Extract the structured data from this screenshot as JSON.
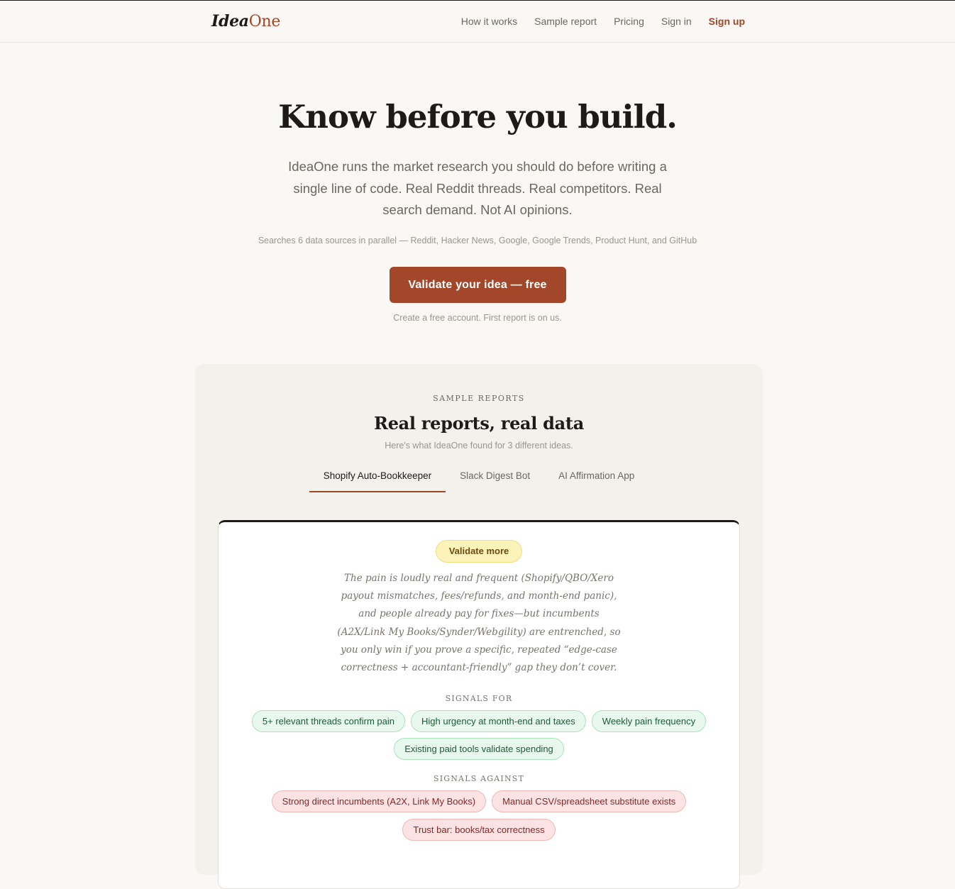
{
  "header": {
    "logo_part1": "Idea",
    "logo_part2": "One",
    "nav": [
      {
        "label": "How it works"
      },
      {
        "label": "Sample report"
      },
      {
        "label": "Pricing"
      },
      {
        "label": "Sign in"
      },
      {
        "label": "Sign up"
      }
    ]
  },
  "hero": {
    "title": "Know before you build.",
    "lead": "IdeaOne runs the market research you should do before writing a single line of code. Real Reddit threads. Real competitors. Real search demand. Not AI opinions.",
    "sources": "Searches 6 data sources in parallel — Reddit, Hacker News, Google, Google Trends, Product Hunt, and GitHub",
    "cta_label": "Validate your idea — free",
    "note": "Create a free account. First report is on us."
  },
  "samples": {
    "eyebrow": "SAMPLE REPORTS",
    "title": "Real reports, real data",
    "subtitle": "Here's what IdeaOne found for 3 different ideas.",
    "tabs": [
      {
        "label": "Shopify Auto-Bookkeeper",
        "active": true
      },
      {
        "label": "Slack Digest Bot",
        "active": false
      },
      {
        "label": "AI Affirmation App",
        "active": false
      }
    ],
    "report": {
      "verdict": "Validate more",
      "summary": "The pain is loudly real and frequent (Shopify/QBO/Xero payout mismatches, fees/refunds, and month-end panic), and people already pay for fixes—but incumbents (A2X/Link My Books/Synder/Webgility) are entrenched, so you only win if you prove a specific, repeated “edge-case correctness + accountant-friendly” gap they don’t cover.",
      "signals_for_label": "SIGNALS FOR",
      "signals_for": [
        "5+ relevant threads confirm pain",
        "High urgency at month-end and taxes",
        "Weekly pain frequency",
        "Existing paid tools validate spending"
      ],
      "signals_against_label": "SIGNALS AGAINST",
      "signals_against": [
        "Strong direct incumbents (A2X, Link My Books)",
        "Manual CSV/spreadsheet substitute exists",
        "Trust bar: books/tax correctness"
      ]
    }
  },
  "colors": {
    "accent": "#a3472a",
    "background": "#f9f8f4",
    "verdict_bg": "#fbf3b9",
    "signal_for_bg": "#e9f8ee",
    "signal_against_bg": "#fbe3e3"
  }
}
